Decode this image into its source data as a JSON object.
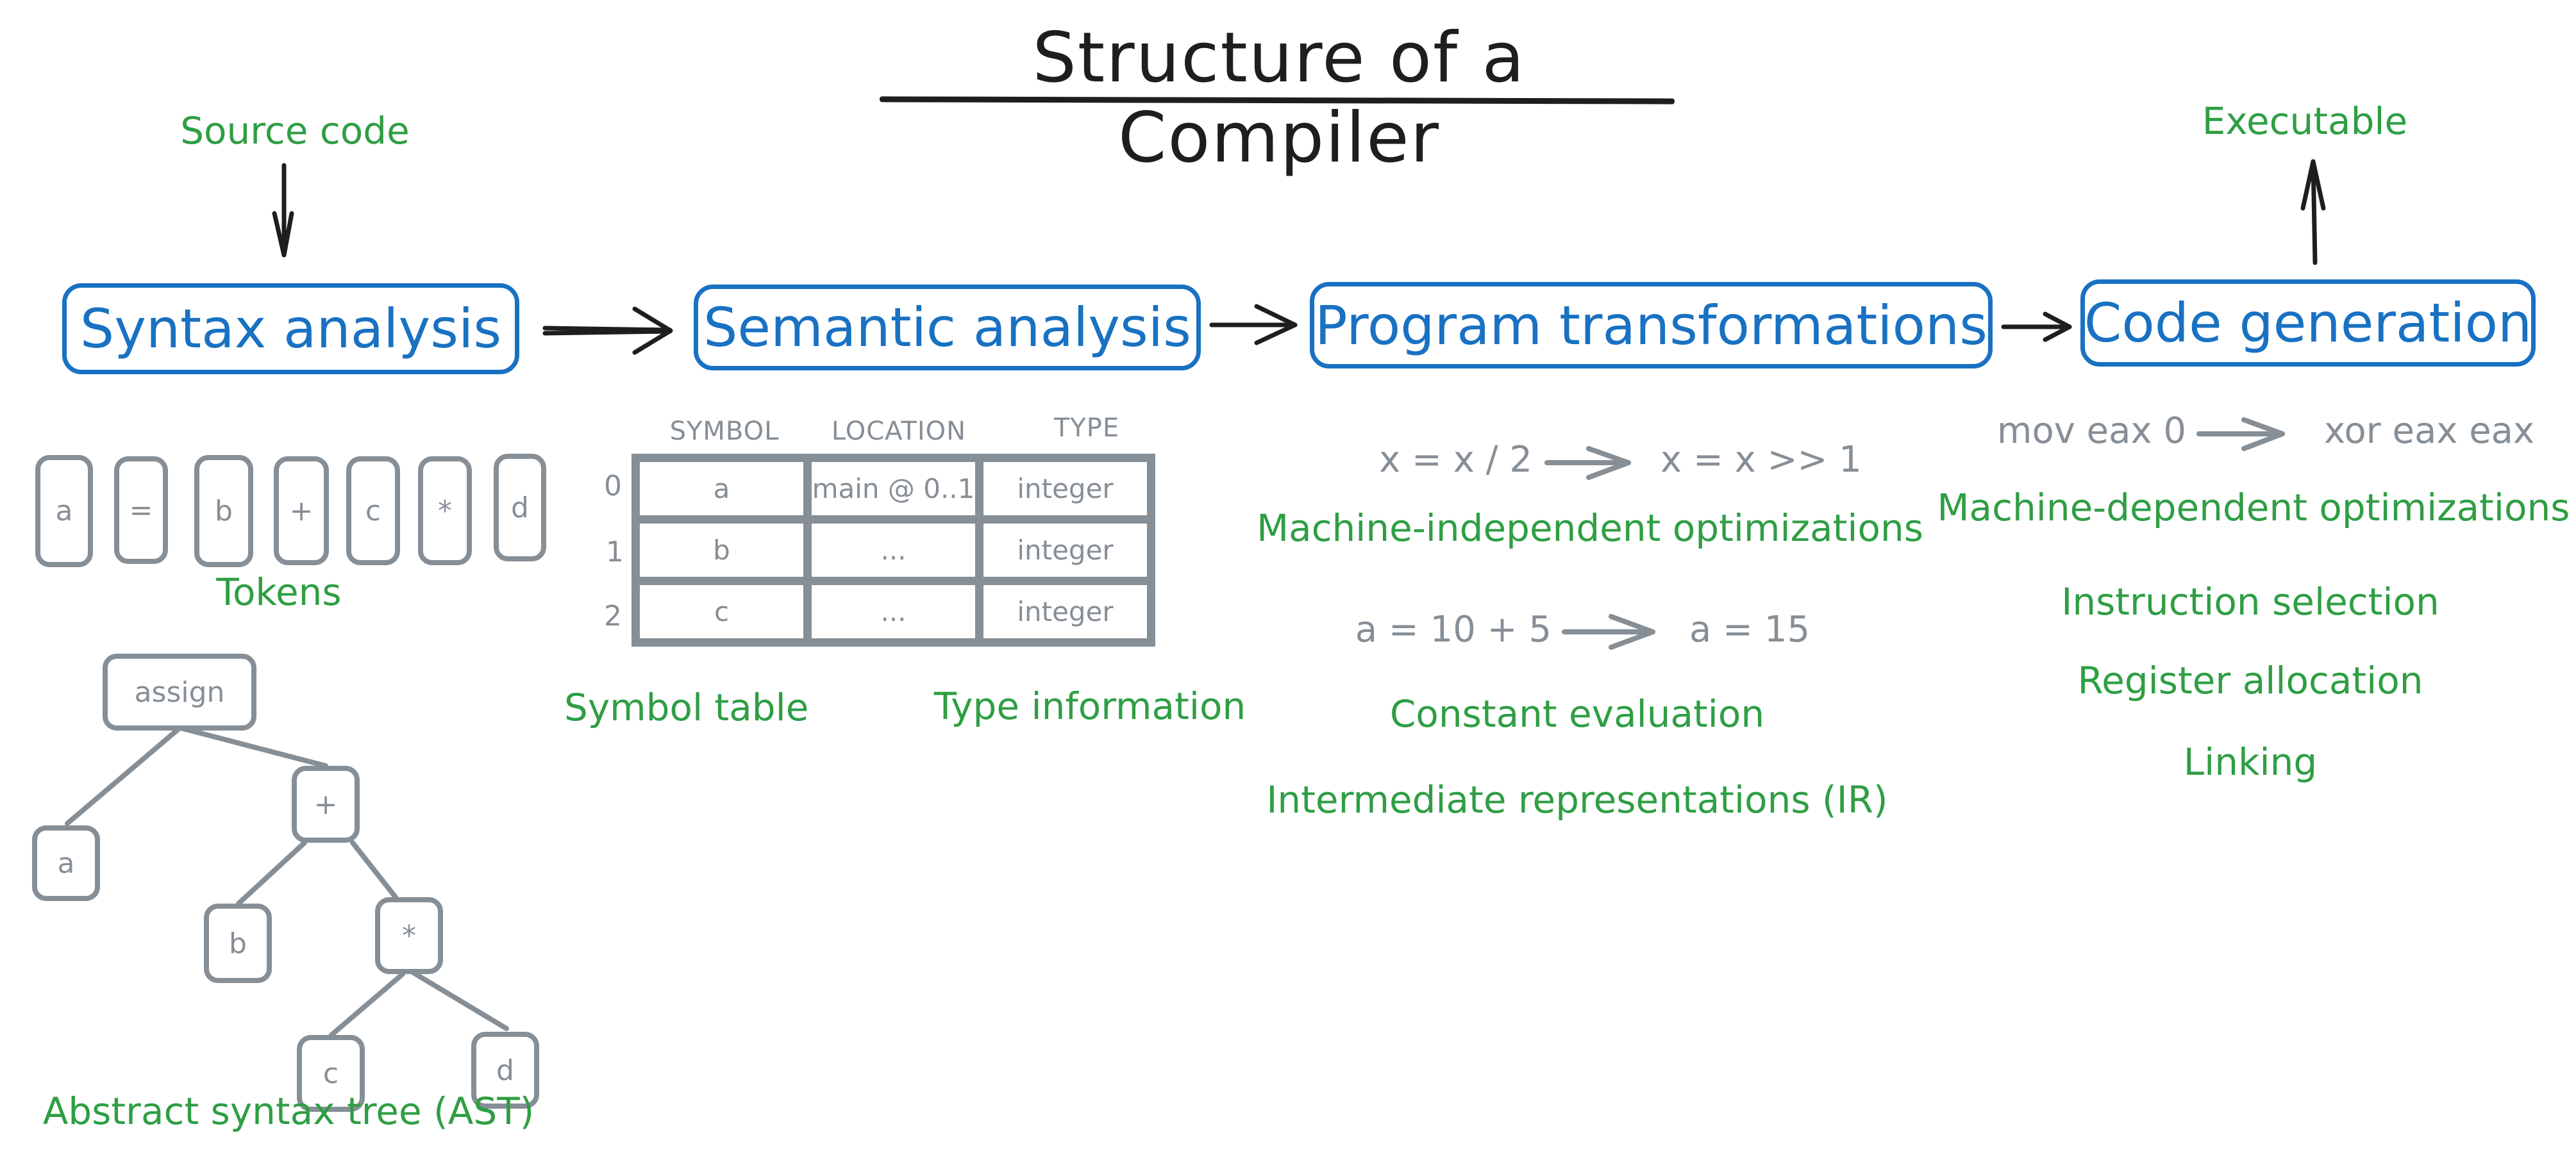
{
  "title": "Structure of a Compiler",
  "input_label": "Source code",
  "output_label": "Executable",
  "colors": {
    "stage": "#1971c2",
    "annotation": "#2f9e44",
    "example": "#868e96",
    "arrow": "#1e1e1e"
  },
  "stages": [
    {
      "label": "Syntax analysis"
    },
    {
      "label": "Semantic analysis"
    },
    {
      "label": "Program transformations"
    },
    {
      "label": "Code generation"
    }
  ],
  "syntax": {
    "tokens": [
      "a",
      "=",
      "b",
      "+",
      "c",
      "*",
      "d"
    ],
    "tokens_label": "Tokens",
    "ast": {
      "nodes": [
        {
          "id": "assign",
          "label": "assign"
        },
        {
          "id": "a",
          "label": "a"
        },
        {
          "id": "plus",
          "label": "+"
        },
        {
          "id": "b",
          "label": "b"
        },
        {
          "id": "times",
          "label": "*"
        },
        {
          "id": "c",
          "label": "c"
        },
        {
          "id": "d",
          "label": "d"
        }
      ],
      "edges": [
        [
          "assign",
          "a"
        ],
        [
          "assign",
          "plus"
        ],
        [
          "plus",
          "b"
        ],
        [
          "plus",
          "times"
        ],
        [
          "times",
          "c"
        ],
        [
          "times",
          "d"
        ]
      ]
    },
    "ast_label": "Abstract syntax tree (AST)"
  },
  "semantic": {
    "table": {
      "columns": [
        "SYMBOL",
        "LOCATION",
        "TYPE"
      ],
      "rows": [
        {
          "index": "0",
          "cells": [
            "a",
            "main @ 0..1",
            "integer"
          ]
        },
        {
          "index": "1",
          "cells": [
            "b",
            "...",
            "integer"
          ]
        },
        {
          "index": "2",
          "cells": [
            "c",
            "...",
            "integer"
          ]
        }
      ]
    },
    "symbol_table_label": "Symbol table",
    "type_info_label": "Type information"
  },
  "transformations": {
    "example1": {
      "before": "x = x / 2",
      "after": "x = x >> 1"
    },
    "label1": "Machine-independent optimizations",
    "example2": {
      "before": "a = 10 + 5",
      "after": "a = 15"
    },
    "label2": "Constant evaluation",
    "label3": "Intermediate representations (IR)"
  },
  "codegen": {
    "example": {
      "before": "mov eax 0",
      "after": "xor eax eax"
    },
    "label1": "Machine-dependent optimizations",
    "items": [
      "Instruction selection",
      "Register allocation",
      "Linking"
    ]
  }
}
